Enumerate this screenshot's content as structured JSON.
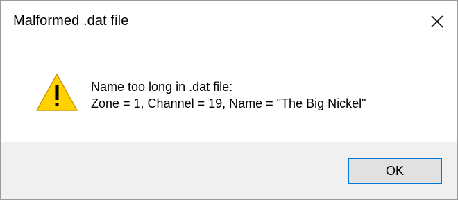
{
  "window": {
    "title": "Malformed .dat file",
    "close_icon": "close-icon"
  },
  "message": {
    "icon": "warning-icon",
    "line1": "Name too long in .dat file:",
    "line2": "Zone = 1, Channel = 19, Name = \"The Big Nickel\""
  },
  "buttons": {
    "ok_label": "OK"
  },
  "colors": {
    "footer_bg": "#f0f0f0",
    "button_focus_border": "#0078d7",
    "button_bg": "#e1e1e1",
    "warning_fill": "#ffd200"
  }
}
